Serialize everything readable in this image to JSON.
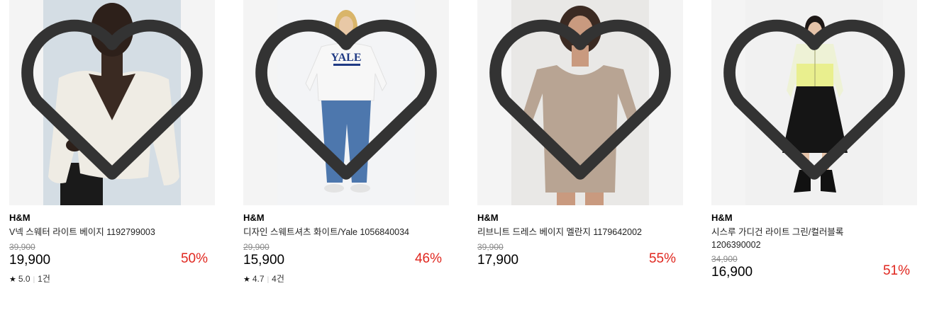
{
  "products": [
    {
      "brand": "H&M",
      "name": "V넥 스웨터 라이트 베이지 1192799003",
      "original_price": "39,900",
      "sale_price": "19,900",
      "discount": "50%",
      "rating": "5.0",
      "review_count": "1건",
      "image_bg": "#d4dde4",
      "wishlist_icon": "heart-outline-icon"
    },
    {
      "brand": "H&M",
      "name": "디자인 스웨트셔츠 화이트/Yale 1056840034",
      "original_price": "29,900",
      "sale_price": "15,900",
      "discount": "46%",
      "rating": "4.7",
      "review_count": "4건",
      "image_bg": "#f3f4f6",
      "print_text": "YALE",
      "wishlist_icon": "heart-outline-icon"
    },
    {
      "brand": "H&M",
      "name": "리브니트 드레스 베이지 멜란지 1179642002",
      "original_price": "39,900",
      "sale_price": "17,900",
      "discount": "55%",
      "image_bg": "#e9e8e6",
      "wishlist_icon": "heart-outline-icon"
    },
    {
      "brand": "H&M",
      "name": "시스루 가디건 라이트 그린/컬러블록 1206390002",
      "original_price": "34,900",
      "sale_price": "16,900",
      "discount": "51%",
      "image_bg": "#f1f1f1",
      "wishlist_icon": "heart-outline-icon"
    }
  ],
  "colors": {
    "discount": "#e0271f",
    "strike_price": "#8a8a8a",
    "image_frame": "#f4f4f4"
  }
}
